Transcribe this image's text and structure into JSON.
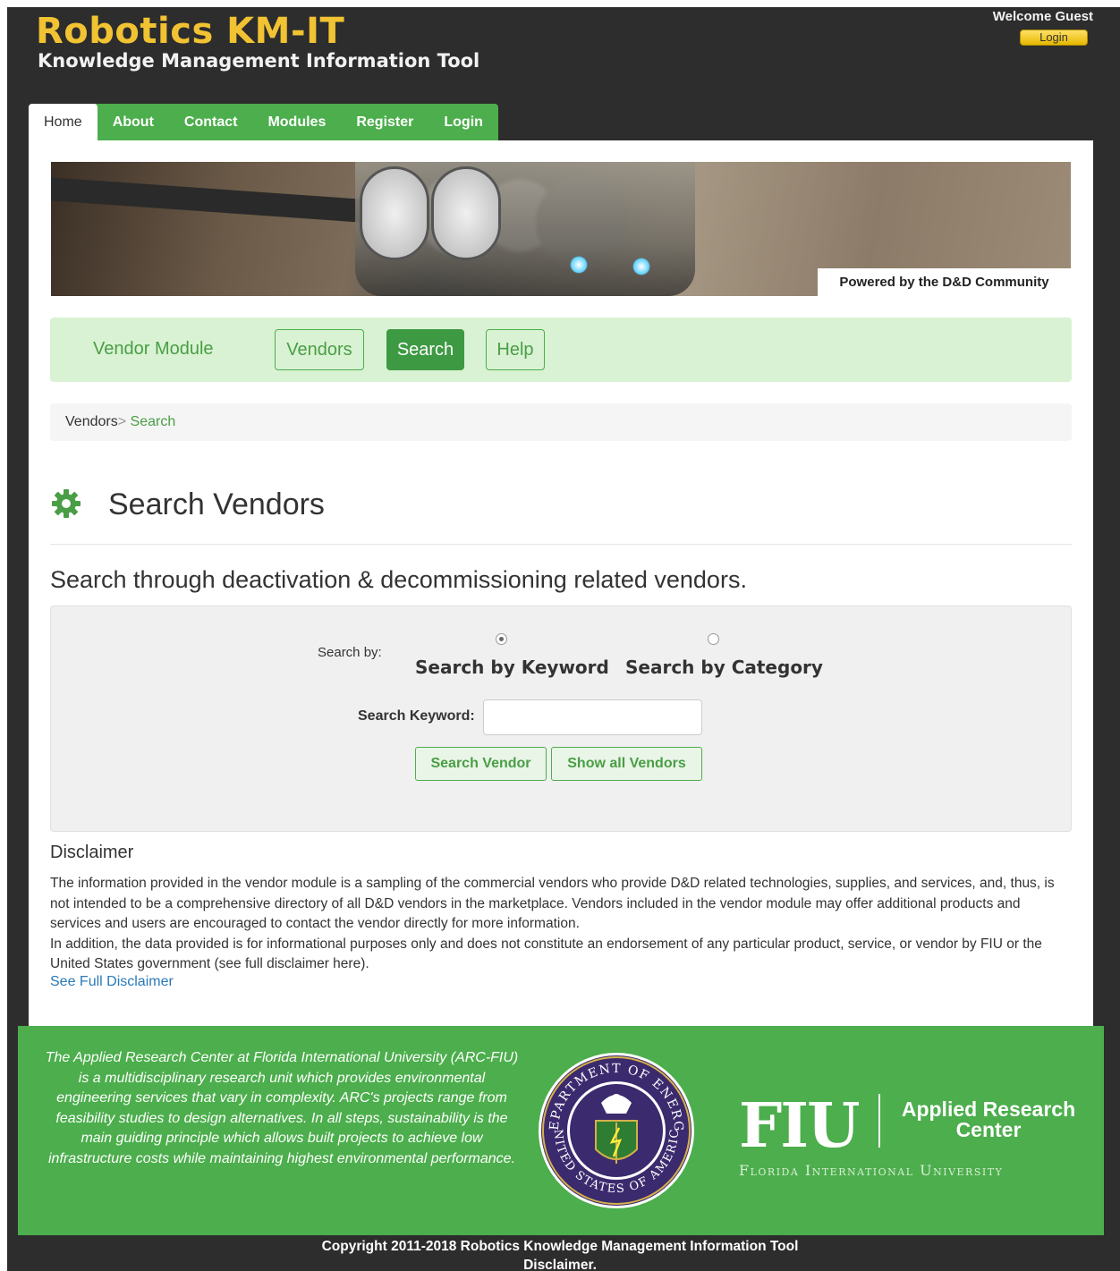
{
  "header": {
    "site_title": "Robotics KM-IT",
    "site_subtitle": "Knowledge Management Information Tool",
    "welcome": "Welcome Guest",
    "login_button": "Login"
  },
  "nav": {
    "tabs": [
      {
        "label": "Home",
        "active": true
      },
      {
        "label": "About"
      },
      {
        "label": "Contact"
      },
      {
        "label": "Modules"
      },
      {
        "label": "Register"
      },
      {
        "label": "Login"
      }
    ]
  },
  "banner": {
    "caption": "Powered by the D&D Community"
  },
  "module": {
    "title": "Vendor Module",
    "buttons": [
      {
        "label": "Vendors"
      },
      {
        "label": "Search",
        "active": true
      },
      {
        "label": "Help"
      }
    ]
  },
  "breadcrumb": {
    "parent": "Vendors",
    "separator": ">",
    "current": "Search"
  },
  "page": {
    "title": "Search Vendors",
    "lead": "Search through deactivation & decommissioning related vendors.",
    "icon": "gear-icon"
  },
  "search": {
    "search_by_label": "Search by:",
    "options": [
      {
        "label": "Search by Keyword",
        "checked": true
      },
      {
        "label": "Search by Category",
        "checked": false
      }
    ],
    "keyword_label": "Search Keyword:",
    "keyword_value": "",
    "search_button": "Search Vendor",
    "show_all_button": "Show all Vendors"
  },
  "disclaimer": {
    "title": "Disclaimer",
    "paragraph1": "The information provided in the vendor module is a sampling of the commercial vendors who provide D&D related technologies, supplies, and services, and, thus, is not intended to be a comprehensive directory of all D&D vendors in the marketplace. Vendors included in the vendor module may offer additional products and services and users are encouraged to contact the vendor directly for more information.",
    "paragraph2": "In addition, the data provided is for informational purposes only and does not constitute an endorsement of any particular product, service, or vendor by FIU or the United States government (see full disclaimer here).",
    "link": "See Full Disclaimer"
  },
  "footer": {
    "about": "The Applied Research Center at Florida International University (ARC-FIU) is a multidisciplinary research unit which provides environmental engineering services that vary in complexity. ARC's projects range from feasibility studies to design alternatives. In all steps, sustainability is the main guiding principle which allows built projects to achieve low infrastructure costs while maintaining highest environmental performance.",
    "seal_text_top": "DEPARTMENT OF ENERGY",
    "seal_text_bottom": "UNITED STATES OF AMERICA",
    "fiu_logo": "FIU",
    "arc_name": "Applied Research Center",
    "fiu_full": "Florida International University",
    "copyright": "Copyright 2011-2018 Robotics Knowledge Management Information Tool",
    "disclaimer_link": "Disclaimer."
  },
  "colors": {
    "frame": "#2d2d2d",
    "title_gold": "#f1c232",
    "green": "#4cae4c",
    "green_dark": "#3d9a42",
    "green_light": "#d9f2d3",
    "link_blue": "#2a7ab9"
  }
}
